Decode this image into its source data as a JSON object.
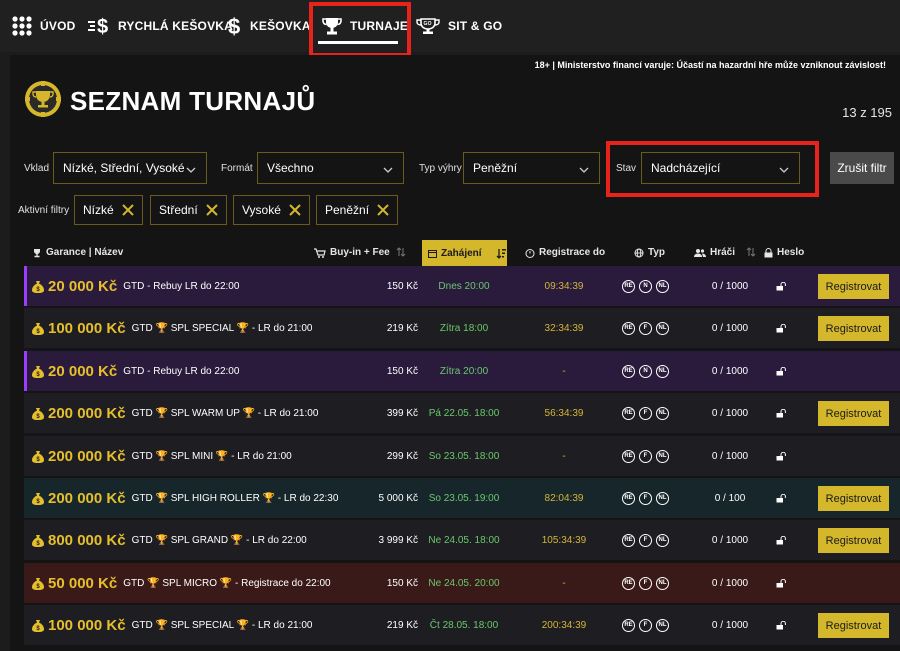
{
  "nav": {
    "items": [
      {
        "label": "ÚVOD",
        "icon": "grid-icon"
      },
      {
        "label": "RYCHLÁ KEŠOVKA",
        "icon": "fast-dollar-icon"
      },
      {
        "label": "KEŠOVKA",
        "icon": "dollar-icon"
      },
      {
        "label": "TURNAJE",
        "icon": "trophy-icon",
        "active": true
      },
      {
        "label": "SIT & GO",
        "icon": "sitgo-icon"
      }
    ]
  },
  "warning": "18+ | Ministerstvo financí varuje: Účastí na hazardní hře může vzniknout závislost!",
  "title": "SEZNAM TURNAJŮ",
  "count": "13 z 195",
  "filters": {
    "vklad_label": "Vklad",
    "vklad_value": "Nízké, Střední, Vysoké",
    "format_label": "Formát",
    "format_value": "Všechno",
    "typ_label": "Typ výhry",
    "typ_value": "Peněžní",
    "stav_label": "Stav",
    "stav_value": "Nadcházející",
    "clear_label": "Zrušit filtr",
    "active_label": "Aktivní filtry",
    "chips": [
      "Nízké",
      "Střední",
      "Vysoké",
      "Peněžní"
    ]
  },
  "table": {
    "headers": {
      "name": "Garance | Název",
      "buyin": "Buy-in + Fee",
      "start": "Zahájení",
      "reg": "Registrace do",
      "type": "Typ",
      "players": "Hráči",
      "password": "Heslo"
    },
    "register_label": "Registrovat",
    "rows": [
      {
        "garance": "20 000 Kč",
        "name": "GTD - Rebuy LR do 22:00",
        "buyin": "150 Kč",
        "start": "Dnes 20:00",
        "reg": "09:34:39",
        "types": [
          "RE",
          "N",
          "NL"
        ],
        "players": "0 / 1000",
        "bg": "#2a1b3d",
        "accent": true,
        "register": true
      },
      {
        "garance": "100 000 Kč",
        "name": "GTD 🏆 SPL SPECIAL 🏆 - LR do 21:00",
        "buyin": "219 Kč",
        "start": "Zítra 18:00",
        "reg": "32:34:39",
        "types": [
          "RE",
          "F",
          "NL"
        ],
        "players": "0 / 1000",
        "bg": "#1e1e22",
        "accent": false,
        "register": true
      },
      {
        "garance": "20 000 Kč",
        "name": "GTD - Rebuy LR do 22:00",
        "buyin": "150 Kč",
        "start": "Zítra 20:00",
        "reg": "-",
        "types": [
          "RE",
          "N",
          "NL"
        ],
        "players": "0 / 1000",
        "bg": "#2a1b3d",
        "accent": true,
        "register": false
      },
      {
        "garance": "200 000 Kč",
        "name": "GTD 🏆 SPL WARM UP 🏆 - LR do 21:00",
        "buyin": "399 Kč",
        "start": "Pá 22.05. 18:00",
        "reg": "56:34:39",
        "types": [
          "RE",
          "F",
          "NL"
        ],
        "players": "0 / 1000",
        "bg": "#1e1e22",
        "accent": false,
        "register": true
      },
      {
        "garance": "200 000 Kč",
        "name": "GTD 🏆 SPL MINI 🏆 - LR do 21:00",
        "buyin": "299 Kč",
        "start": "So 23.05. 18:00",
        "reg": "-",
        "types": [
          "RE",
          "F",
          "NL"
        ],
        "players": "0 / 1000",
        "bg": "#1e1e22",
        "accent": false,
        "register": false
      },
      {
        "garance": "200 000 Kč",
        "name": "GTD 🏆 SPL HIGH ROLLER 🏆 - LR do 22:30",
        "buyin": "5 000 Kč",
        "start": "So 23.05. 19:00",
        "reg": "82:04:39",
        "types": [
          "RE",
          "F",
          "NL"
        ],
        "players": "0 / 100",
        "bg": "#16262b",
        "accent": false,
        "register": true
      },
      {
        "garance": "800 000 Kč",
        "name": "GTD 🏆 SPL GRAND 🏆 - LR do 22:00",
        "buyin": "3 999 Kč",
        "start": "Ne 24.05. 18:00",
        "reg": "105:34:39",
        "types": [
          "RE",
          "F",
          "NL"
        ],
        "players": "0 / 1000",
        "bg": "#1e1e22",
        "accent": false,
        "register": true
      },
      {
        "garance": "50 000 Kč",
        "name": "GTD 🏆 SPL MICRO 🏆 - Registrace do 22:00",
        "buyin": "150 Kč",
        "start": "Ne 24.05. 20:00",
        "reg": "-",
        "types": [
          "RE",
          "F",
          "NL"
        ],
        "players": "0 / 1000",
        "bg": "#3a1a18",
        "accent": false,
        "register": false
      },
      {
        "garance": "100 000 Kč",
        "name": "GTD 🏆 SPL SPECIAL 🏆 - LR do 21:00",
        "buyin": "219 Kč",
        "start": "Čt 28.05. 18:00",
        "reg": "200:34:39",
        "types": [
          "RE",
          "F",
          "NL"
        ],
        "players": "0 / 1000",
        "bg": "#1e1e22",
        "accent": false,
        "register": true
      }
    ]
  },
  "colors": {
    "accent_gold": "#d4b72a",
    "highlight_red": "#e8231b",
    "live_green": "#69c86d"
  }
}
